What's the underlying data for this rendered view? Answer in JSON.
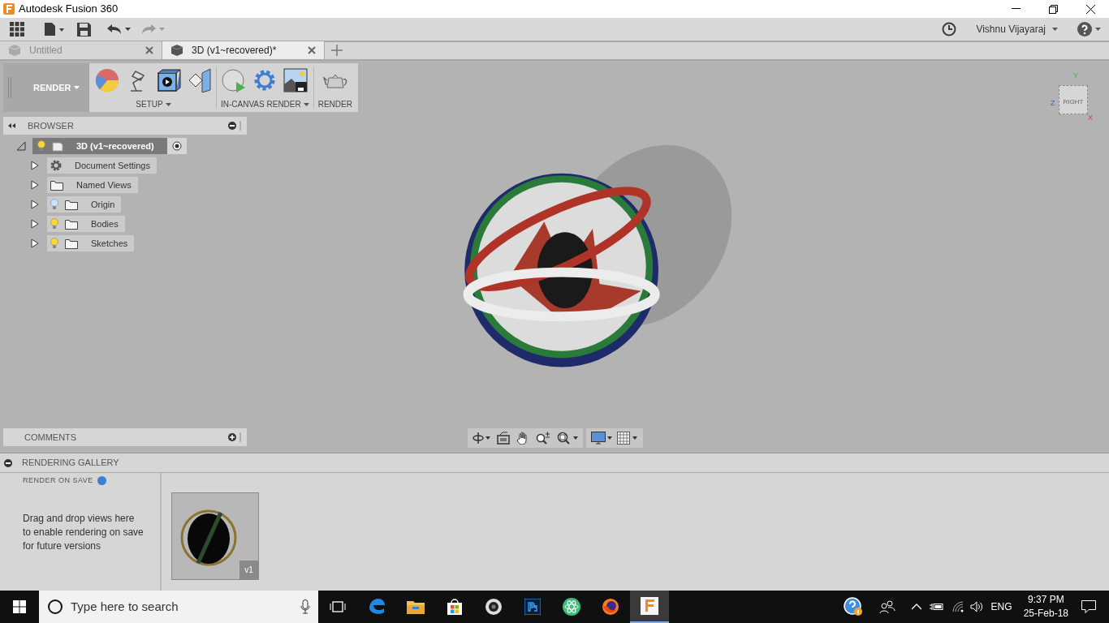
{
  "window": {
    "title": "Autodesk Fusion 360"
  },
  "toolbar": {
    "user": "Vishnu Vijayaraj"
  },
  "tabs": [
    {
      "label": "Untitled",
      "selected": false
    },
    {
      "label": "3D (v1~recovered)*",
      "selected": true
    }
  ],
  "ribbon": {
    "workspace": "RENDER",
    "groups": [
      {
        "label": "SETUP"
      },
      {
        "label": "IN-CANVAS RENDER"
      },
      {
        "label": "RENDER"
      }
    ]
  },
  "viewcube": {
    "face": "RIGHT",
    "axes": [
      "Y",
      "Z",
      "X"
    ]
  },
  "browser": {
    "title": "BROWSER",
    "root": {
      "label": "3D (v1~recovered)",
      "visible": true,
      "active": true
    },
    "items": [
      {
        "label": "Document Settings",
        "kind": "settings"
      },
      {
        "label": "Named Views",
        "kind": "views"
      },
      {
        "label": "Origin",
        "kind": "folder",
        "visible": false
      },
      {
        "label": "Bodies",
        "kind": "folder",
        "visible": true
      },
      {
        "label": "Sketches",
        "kind": "folder",
        "visible": true
      }
    ]
  },
  "comments": {
    "title": "COMMENTS"
  },
  "gallery": {
    "title": "RENDERING GALLERY",
    "render_on_save": "RENDER ON SAVE",
    "hint": "Drag and drop views here to enable rendering on save for future versions",
    "thumbnails": [
      {
        "label": "v1"
      }
    ]
  },
  "taskbar": {
    "search": {
      "placeholder": "Type here to search"
    },
    "language": "ENG",
    "time": "9:37 PM",
    "date": "25-Feb-18"
  }
}
